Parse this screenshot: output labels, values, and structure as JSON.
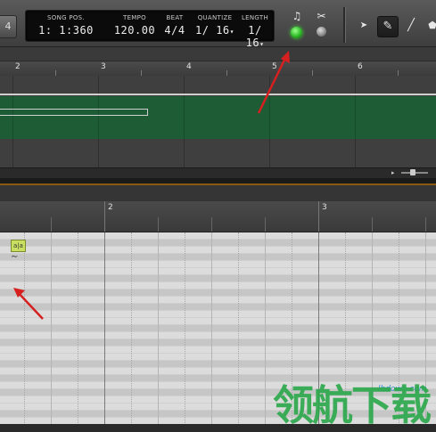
{
  "toolbar": {
    "left_button": "4",
    "lcd": [
      {
        "label": "SONG POS.",
        "value": "1: 1:360"
      },
      {
        "label": "TEMPO",
        "value": "120.00"
      },
      {
        "label": "BEAT",
        "value": "4/4"
      },
      {
        "label": "QUANTIZE",
        "value": "1/ 16"
      },
      {
        "label": "LENGTH",
        "value": "1/ 16"
      }
    ],
    "dropdown_glyph": "▾",
    "metronome_glyph": "♫",
    "tools_glyph": "✂",
    "pointer_glyph": "➤",
    "pencil_glyph": "✎",
    "line_glyph": "╱",
    "eraser_glyph": "⬟"
  },
  "arrange": {
    "bars": [
      "2",
      "3",
      "4",
      "5",
      "6"
    ]
  },
  "pianoroll": {
    "bars": [
      "2",
      "3"
    ],
    "note_chip": "a|a",
    "wave_glyph": "∼"
  },
  "watermark": {
    "site": "lhdown.com",
    "text": "领航下载"
  },
  "colors": {
    "track_green": "#1e5c36",
    "led_green": "#2dbb25",
    "annotation_red": "#d62020",
    "note_yellow": "#c8df62"
  }
}
